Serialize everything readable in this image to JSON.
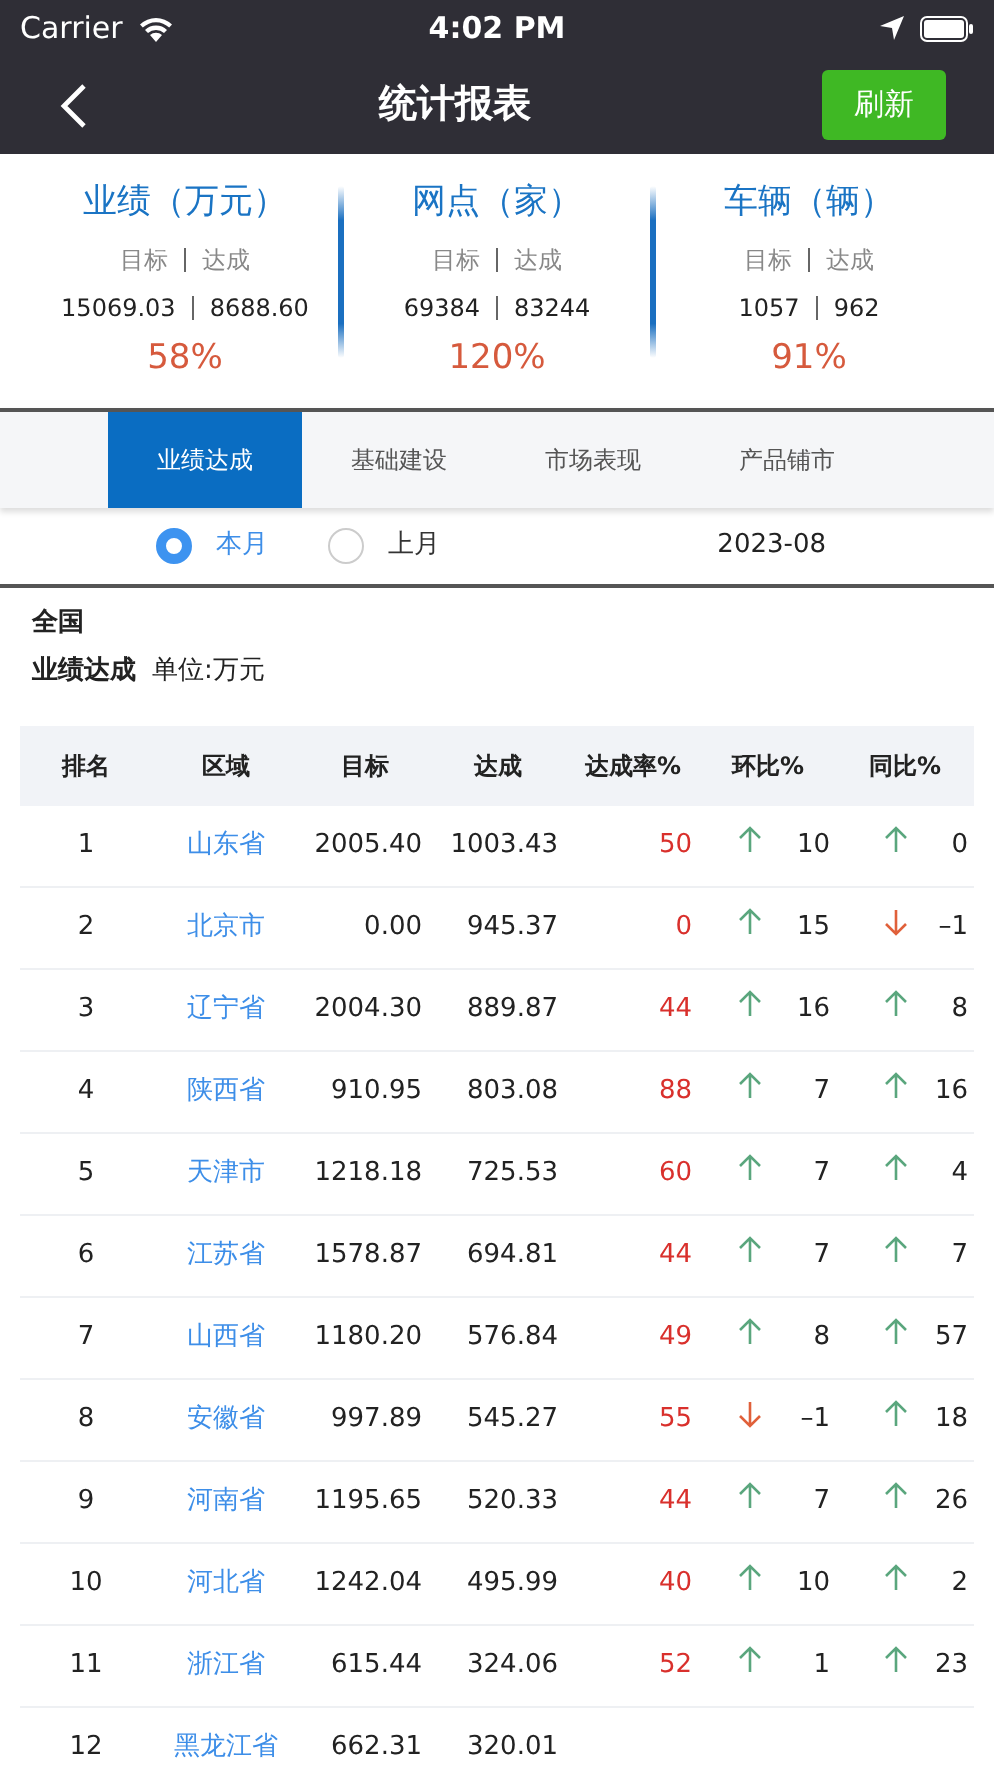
{
  "status_bar": {
    "carrier": "Carrier",
    "time": "4:02 PM"
  },
  "nav": {
    "title": "统计报表",
    "refresh_button": "刷新"
  },
  "stats": [
    {
      "title": "业绩（万元）",
      "target_label": "目标",
      "reach_label": "达成",
      "target": "15069.03",
      "reach": "8688.60",
      "percent": "58%"
    },
    {
      "title": "网点（家）",
      "target_label": "目标",
      "reach_label": "达成",
      "target": "69384",
      "reach": "83244",
      "percent": "120%"
    },
    {
      "title": "车辆（辆）",
      "target_label": "目标",
      "reach_label": "达成",
      "target": "1057",
      "reach": "962",
      "percent": "91%"
    }
  ],
  "tabs": [
    {
      "label": "业绩达成",
      "selected": true
    },
    {
      "label": "基础建设",
      "selected": false
    },
    {
      "label": "市场表现",
      "selected": false
    },
    {
      "label": "产品铺市",
      "selected": false
    }
  ],
  "period": [
    {
      "label": "本月",
      "selected": true
    },
    {
      "label": "上月",
      "selected": false
    }
  ],
  "month": "2023-08",
  "region": "全国",
  "subtitle": "业绩达成",
  "unit": "单位:万元",
  "table": {
    "columns": [
      "排名",
      "区域",
      "目标",
      "达成",
      "达成率%",
      "环比%",
      "同比%"
    ],
    "rows": [
      {
        "rank": "1",
        "area": "山东省",
        "target": "2005.40",
        "reach": "1003.43",
        "rate": "50",
        "mom_up": true,
        "mom": "10",
        "yoy_up": true,
        "yoy": "0"
      },
      {
        "rank": "2",
        "area": "北京市",
        "target": "0.00",
        "reach": "945.37",
        "rate": "0",
        "mom_up": true,
        "mom": "15",
        "yoy_up": false,
        "yoy": "–1"
      },
      {
        "rank": "3",
        "area": "辽宁省",
        "target": "2004.30",
        "reach": "889.87",
        "rate": "44",
        "mom_up": true,
        "mom": "16",
        "yoy_up": true,
        "yoy": "8"
      },
      {
        "rank": "4",
        "area": "陕西省",
        "target": "910.95",
        "reach": "803.08",
        "rate": "88",
        "mom_up": true,
        "mom": "7",
        "yoy_up": true,
        "yoy": "16"
      },
      {
        "rank": "5",
        "area": "天津市",
        "target": "1218.18",
        "reach": "725.53",
        "rate": "60",
        "mom_up": true,
        "mom": "7",
        "yoy_up": true,
        "yoy": "4"
      },
      {
        "rank": "6",
        "area": "江苏省",
        "target": "1578.87",
        "reach": "694.81",
        "rate": "44",
        "mom_up": true,
        "mom": "7",
        "yoy_up": true,
        "yoy": "7"
      },
      {
        "rank": "7",
        "area": "山西省",
        "target": "1180.20",
        "reach": "576.84",
        "rate": "49",
        "mom_up": true,
        "mom": "8",
        "yoy_up": true,
        "yoy": "57"
      },
      {
        "rank": "8",
        "area": "安徽省",
        "target": "997.89",
        "reach": "545.27",
        "rate": "55",
        "mom_up": false,
        "mom": "–1",
        "yoy_up": true,
        "yoy": "18"
      },
      {
        "rank": "9",
        "area": "河南省",
        "target": "1195.65",
        "reach": "520.33",
        "rate": "44",
        "mom_up": true,
        "mom": "7",
        "yoy_up": true,
        "yoy": "26"
      },
      {
        "rank": "10",
        "area": "河北省",
        "target": "1242.04",
        "reach": "495.99",
        "rate": "40",
        "mom_up": true,
        "mom": "10",
        "yoy_up": true,
        "yoy": "2"
      },
      {
        "rank": "11",
        "area": "浙江省",
        "target": "615.44",
        "reach": "324.06",
        "rate": "52",
        "mom_up": true,
        "mom": "1",
        "yoy_up": true,
        "yoy": "23"
      },
      {
        "rank": "12",
        "area": "黑龙江省",
        "target": "662.31",
        "reach": "320.01"
      }
    ]
  }
}
